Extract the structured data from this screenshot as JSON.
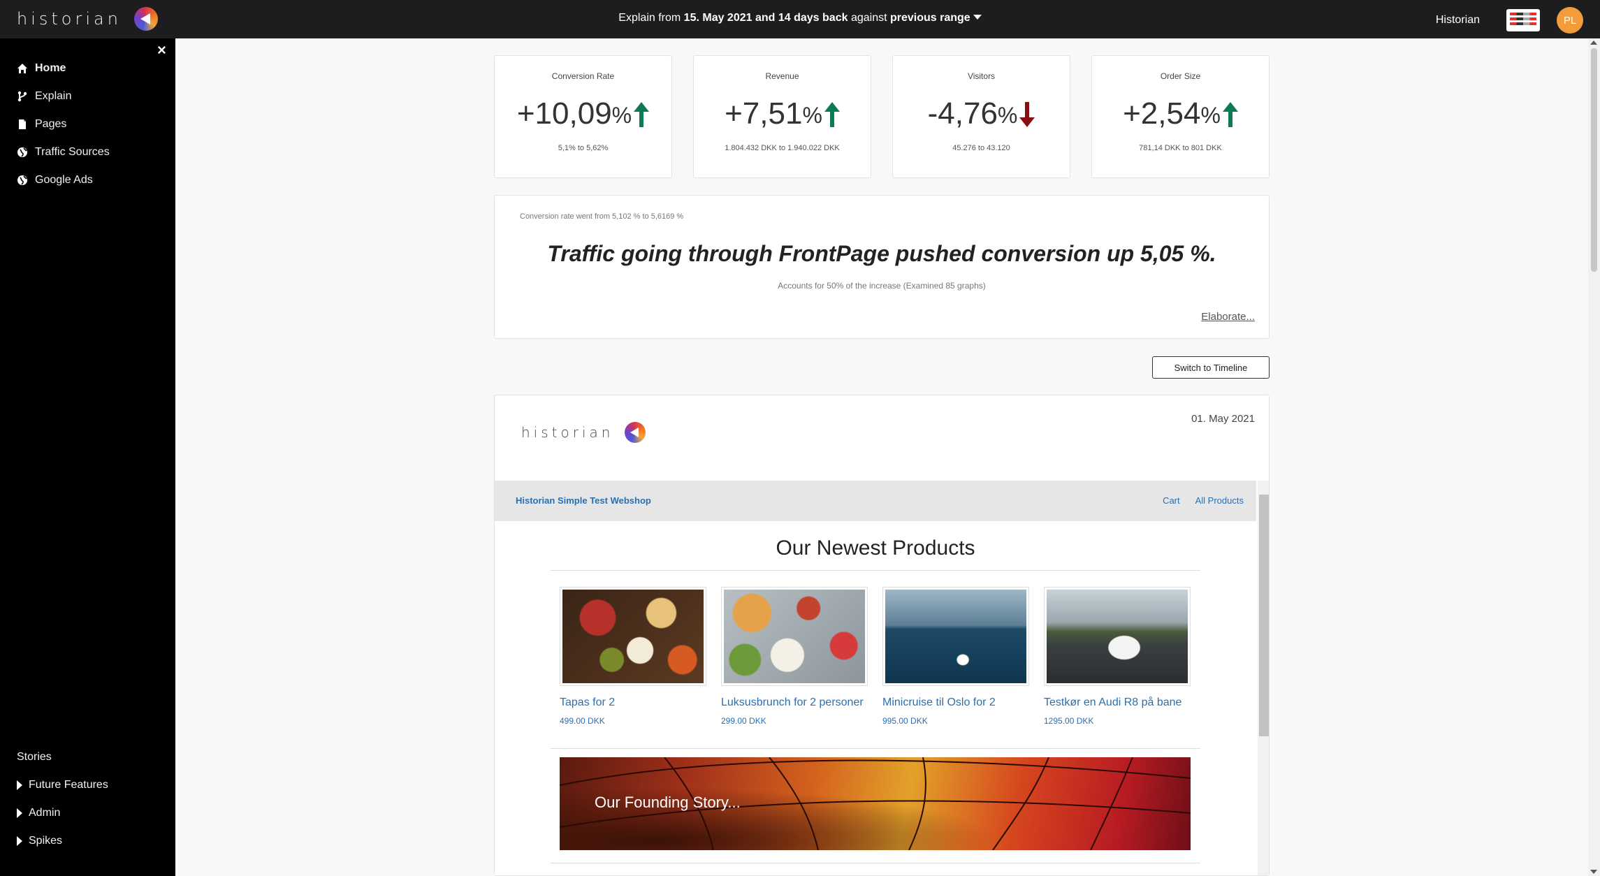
{
  "app": {
    "brand": "historian",
    "explain": {
      "prefix": "Explain from",
      "date_range": "15. May 2021 and 14 days back",
      "against": "against",
      "comparison": "previous range"
    },
    "user_label": "Historian",
    "avatar_initials": "PL"
  },
  "sidebar": {
    "close": "×",
    "items": [
      {
        "label": "Home",
        "icon": "home-icon"
      },
      {
        "label": "Explain",
        "icon": "branch-icon"
      },
      {
        "label": "Pages",
        "icon": "page-icon"
      },
      {
        "label": "Traffic Sources",
        "icon": "globe-icon"
      },
      {
        "label": "Google Ads",
        "icon": "globe-icon"
      }
    ],
    "stories_label": "Stories",
    "tree": [
      {
        "label": "Future Features"
      },
      {
        "label": "Admin"
      },
      {
        "label": "Spikes"
      }
    ]
  },
  "kpis": [
    {
      "title": "Conversion Rate",
      "value": "+10,09",
      "unit": "%",
      "direction": "up",
      "sub": "5,1% to 5,62%"
    },
    {
      "title": "Revenue",
      "value": "+7,51",
      "unit": "%",
      "direction": "up",
      "sub": "1.804.432 DKK to 1.940.022 DKK"
    },
    {
      "title": "Visitors",
      "value": "-4,76",
      "unit": "%",
      "direction": "down",
      "sub": "45.276 to 43.120"
    },
    {
      "title": "Order Size",
      "value": "+2,54",
      "unit": "%",
      "direction": "up",
      "sub": "781,14 DKK to 801 DKK"
    }
  ],
  "colors": {
    "up": "#0f7a5a",
    "down": "#8b0d0d",
    "link": "#2a6fb0"
  },
  "summary": {
    "note": "Conversion rate went from 5,102 % to 5,6169 %",
    "headline": "Traffic going through FrontPage pushed conversion up 5,05 %.",
    "sub": "Accounts for 50% of the increase (Examined 85 graphs)",
    "elaborate": "Elaborate..."
  },
  "timeline_button": "Switch to Timeline",
  "story": {
    "brand": "historian",
    "date": "01. May 2021",
    "webshop": {
      "name": "Historian Simple Test Webshop",
      "links": [
        "Cart",
        "All Products"
      ],
      "title": "Our Newest Products",
      "products": [
        {
          "name": "Tapas for 2",
          "price": "499.00 DKK"
        },
        {
          "name": "Luksusbrunch for 2 personer",
          "price": "299.00 DKK"
        },
        {
          "name": "Minicruise til Oslo for 2",
          "price": "995.00 DKK"
        },
        {
          "name": "Testkør en Audi R8 på bane",
          "price": "1295.00 DKK"
        }
      ],
      "banner": "Our Founding Story..."
    }
  }
}
